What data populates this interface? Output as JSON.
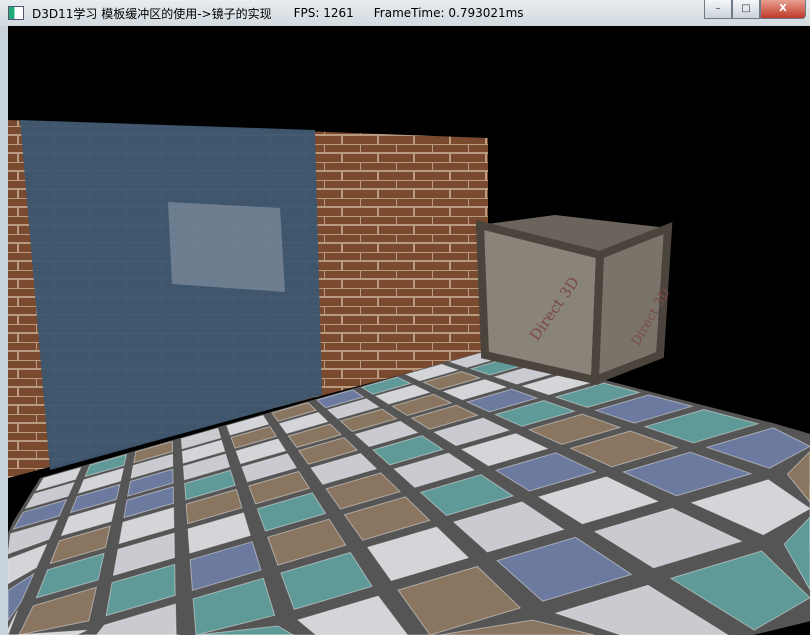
{
  "window": {
    "title": "D3D11学习 模板缓冲区的使用->镜子的实现",
    "fps": "FPS: 1261",
    "frame_time": "FrameTime: 0.793021ms",
    "minimize": "–",
    "maximize": "□",
    "close": "X"
  },
  "scene": {
    "crate_label": "Direct 3D",
    "tile_colors": [
      "#c9cbd0",
      "#6c7aa0",
      "#5f9a98",
      "#8a7560",
      "#d4d5d8"
    ],
    "brick_color": "#7a4a2e",
    "mirror_color": "#3d5670"
  }
}
